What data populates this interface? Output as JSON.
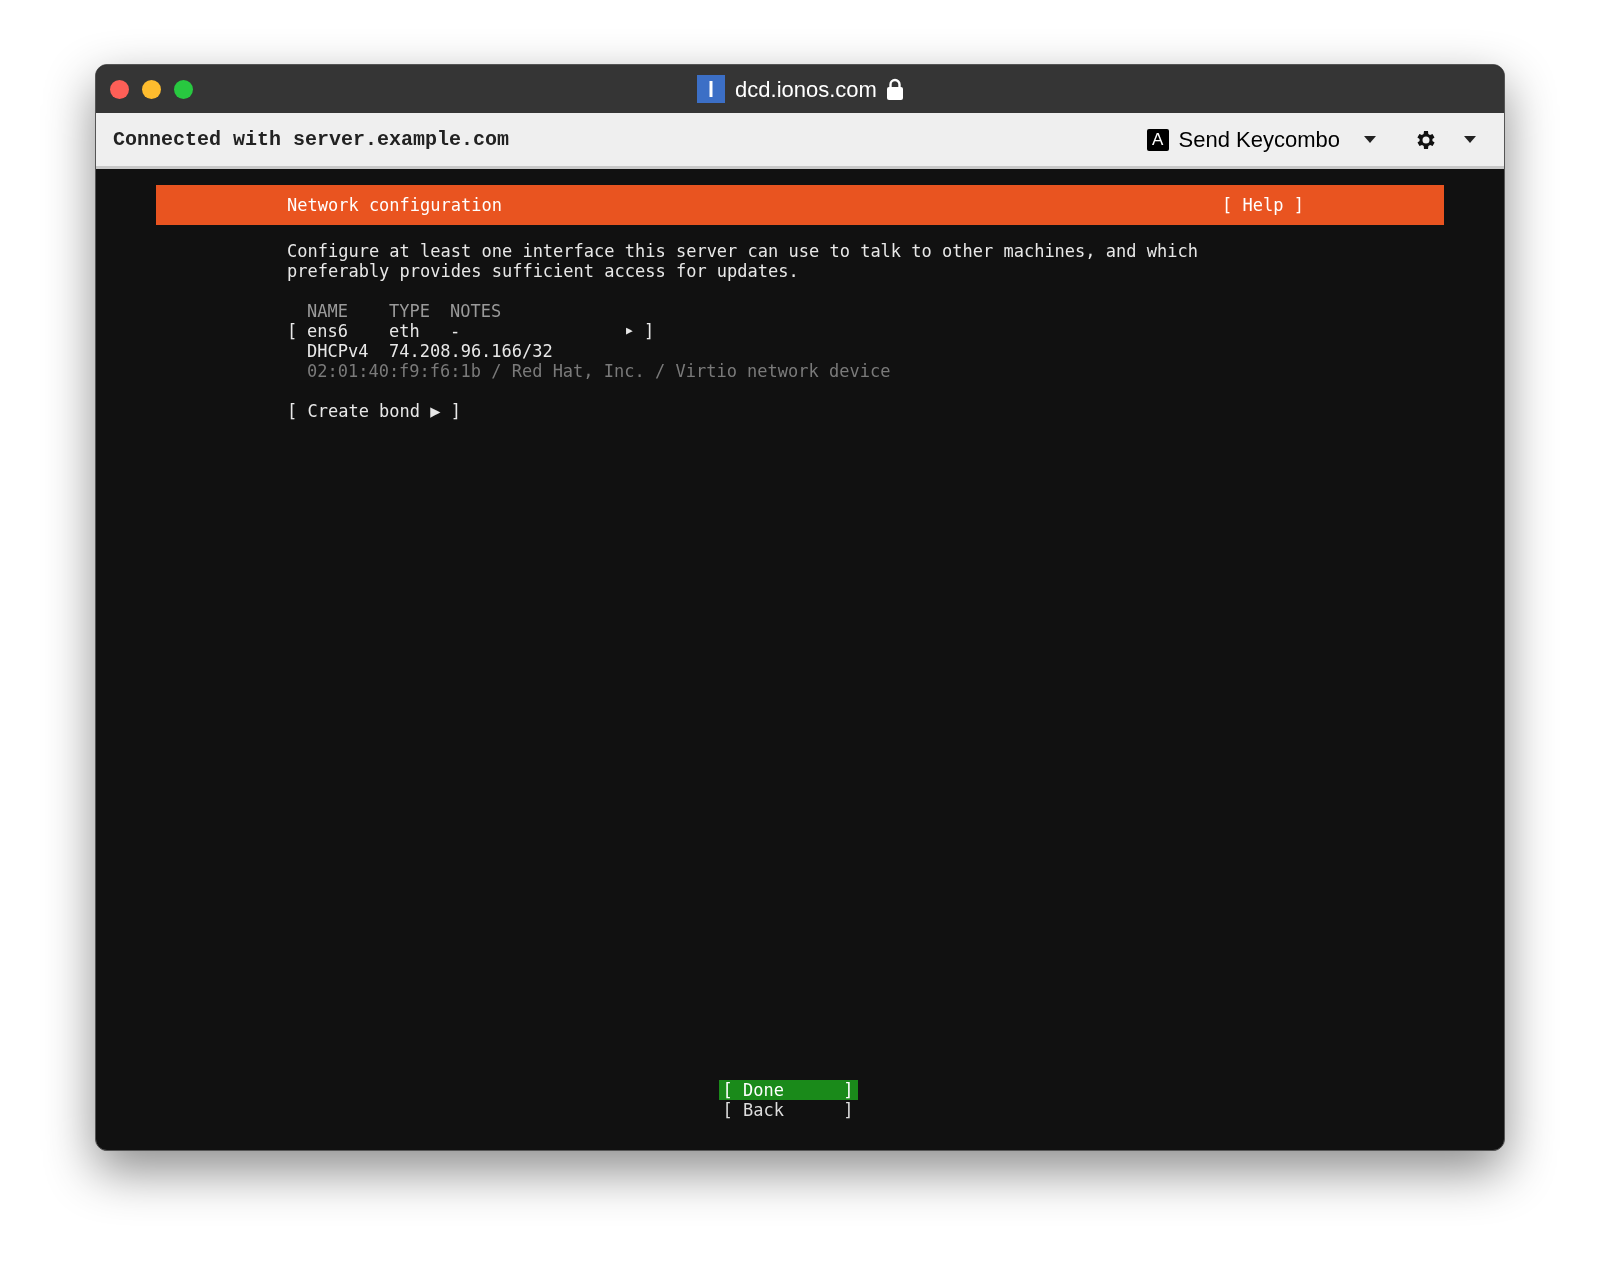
{
  "window": {
    "title": "dcd.ionos.com",
    "secure": true
  },
  "toolbar": {
    "connection": "Connected with server.example.com",
    "key_letter": "A",
    "keycombo": "Send Keycombo"
  },
  "screen": {
    "header": {
      "title": "Network configuration",
      "help": "[ Help ]"
    },
    "description": "Configure at least one interface this server can use to talk to other machines, and which preferably provides sufficient access for updates.",
    "columns": [
      "NAME",
      "TYPE",
      "NOTES"
    ],
    "interfaces": [
      {
        "open": "[",
        "name": "ens6",
        "type": "eth",
        "notes": "-",
        "arrow": "▶",
        "close": "]",
        "address_type": "DHCPv4",
        "address": "74.208.96.166/32",
        "details": "02:01:40:f9:f6:1b / Red Hat, Inc. / Virtio network device"
      }
    ],
    "create_bond": "[ Create bond ▶ ]",
    "buttons": [
      {
        "open": "[",
        "label": "Done",
        "close": "]",
        "selected": true
      },
      {
        "open": "[",
        "label": "Back",
        "close": "]",
        "selected": false
      }
    ]
  }
}
